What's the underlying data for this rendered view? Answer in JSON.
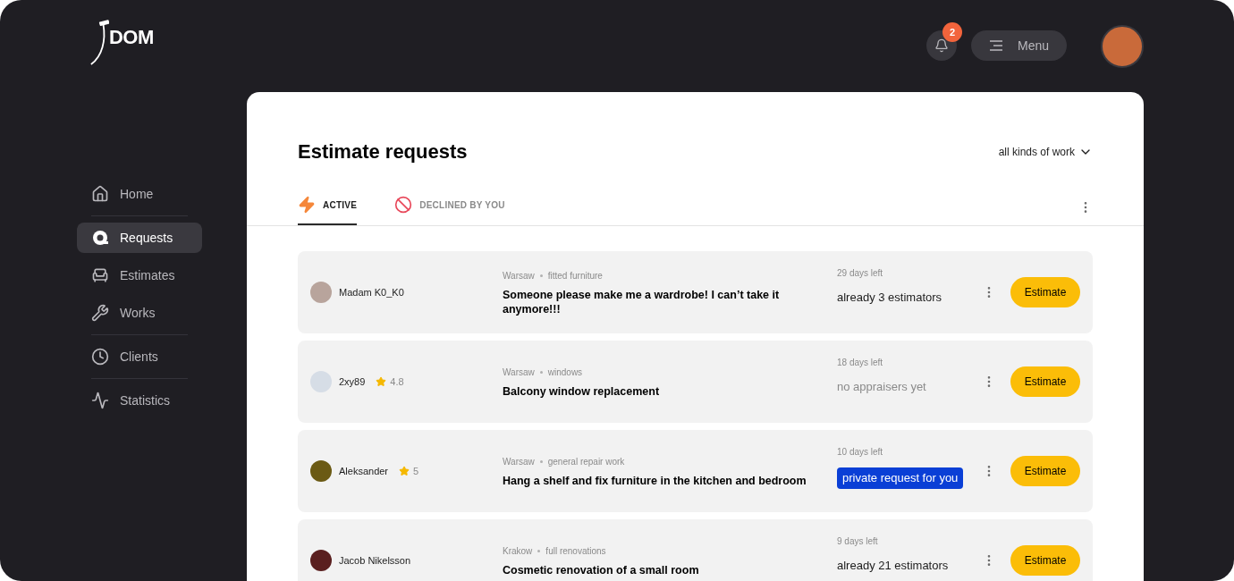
{
  "logo": {
    "text": "DOM"
  },
  "sidebar": {
    "items": [
      {
        "label": "Home",
        "selected": false,
        "divider_after": true
      },
      {
        "label": "Requests",
        "selected": true,
        "divider_after": false
      },
      {
        "label": "Estimates",
        "selected": false,
        "divider_after": false
      },
      {
        "label": "Works",
        "selected": false,
        "divider_after": true
      },
      {
        "label": "Clients",
        "selected": false,
        "divider_after": true
      },
      {
        "label": "Statistics",
        "selected": false,
        "divider_after": false
      }
    ]
  },
  "header": {
    "notifications": "2",
    "menu_label": "Menu"
  },
  "page": {
    "title": "Estimate requests",
    "filter": "all kinds of work",
    "tabs": [
      {
        "label": "ACTIVE",
        "selected": true
      },
      {
        "label": "DECLINED BY YOU",
        "selected": false
      }
    ],
    "requests": [
      {
        "author": "Madam K0_K0",
        "city": "Warsaw",
        "category": "fitted furniture",
        "title": "Someone please make me a wardrobe! I can’t take it anymore!!!",
        "deadline": "29 days left",
        "status": {
          "kind": "count",
          "text": "already 3 estimators"
        },
        "action": "Estimate"
      },
      {
        "author": "2xy89",
        "rating": "4.8",
        "city": "Warsaw",
        "category": "windows",
        "title": "Balcony window replacement",
        "deadline": "18 days left",
        "status": {
          "kind": "none",
          "text": "no appraisers yet"
        },
        "action": "Estimate"
      },
      {
        "author": "Aleksander",
        "rating": "5",
        "city": "Warsaw",
        "category": "general repair work",
        "title": "Hang a shelf and fix furniture in the kitchen and bedroom",
        "deadline": "10 days left",
        "status": {
          "kind": "private",
          "text": "private request for you"
        },
        "action": "Estimate"
      },
      {
        "author": "Jacob Nikelsson",
        "city": "Krakow",
        "category": "full renovations",
        "title": "Cosmetic renovation of a small room",
        "deadline": "9 days left",
        "status": {
          "kind": "count",
          "text": "already 21 estimators"
        },
        "action": "Estimate"
      }
    ]
  }
}
